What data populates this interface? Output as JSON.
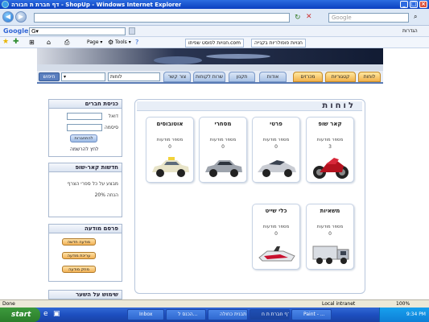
{
  "window": {
    "title": "דף חברת ת חבורה - ShopUp - Windows Internet Explorer",
    "min": "_",
    "max": "□",
    "close": "×"
  },
  "address": {
    "url": "",
    "search_placeholder": "Google"
  },
  "google_bar": {
    "logo": "Google",
    "g_label": "G▾",
    "right_label": "הגדרות"
  },
  "favorites": {
    "tabs": [
      "חנויות לפוסט שפיתו.com",
      "חנויות פופולריות בקנייה"
    ],
    "page_label": "Page ▾",
    "tools_label": "Tools ▾"
  },
  "nav": {
    "tabs": [
      "לוחות",
      "קטגוריות",
      "מכרזים",
      "אודות",
      "תקנון",
      "שרות לקוחות",
      "צור קשר"
    ],
    "search_value": "לוחות",
    "go_label": "חיפוש"
  },
  "members": {
    "title": "כניסת חברים",
    "email_label": "דואל",
    "password_label": "סיסמה",
    "login_btn": "להתחברות",
    "register_link": "לחץ להרשמה"
  },
  "news": {
    "title": "חדשות קאר-שופ",
    "line1": "מבצע על כל ספרי הצרף",
    "line2": "20% הנחה"
  },
  "ads": {
    "title": "פרסם מודעה",
    "btn1": "מודעה חדשה",
    "btn2": "עריכת מודעה",
    "btn3": "מחק מודעה"
  },
  "lower_box": {
    "title": "שימוש על השער"
  },
  "boards": {
    "title": "לוחות",
    "cards": [
      {
        "title": "קאר שופ",
        "sub": "מספר מודעות",
        "count": "3",
        "icon": "motorcycle-icon"
      },
      {
        "title": "פרטי",
        "sub": "מספר מודעות",
        "count": "0",
        "icon": "sportscar-icon"
      },
      {
        "title": "מסחרי",
        "sub": "מספר מודעות",
        "count": "0",
        "icon": "sedan-icon"
      },
      {
        "title": "אוטובוסים",
        "sub": "מספר מודעות",
        "count": "0",
        "icon": "taxi-icon"
      },
      {
        "title": "משאיות",
        "sub": "מספר מודעות",
        "count": "0",
        "icon": "truck-icon"
      },
      {
        "title": "כלי שייט",
        "sub": "מספר מודעות",
        "count": "0",
        "icon": "jetski-icon"
      }
    ]
  },
  "status": {
    "left": "Done",
    "zone": "Local intranet",
    "zoom": "100%"
  },
  "taskbar": {
    "start": "start",
    "tasks": [
      "Inbox",
      "הכנס ל...",
      "תבנית כחולה",
      "דף חברת ת ח...",
      "Paint - ..."
    ],
    "clock": "9:34 PM"
  },
  "colors": {
    "title_blue": "#0a3fbf",
    "tab_orange": "#f2b24b",
    "nav_line": "#5a7bb5"
  }
}
